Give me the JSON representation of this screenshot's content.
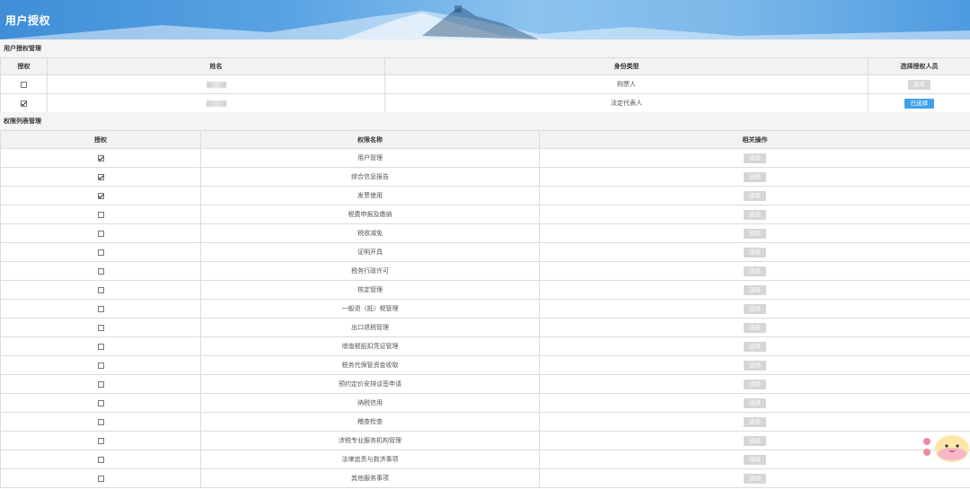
{
  "header": {
    "title": "用户授权"
  },
  "user_section": {
    "title": "用户授权管理",
    "columns": [
      "授权",
      "姓名",
      "身份类型",
      "选择授权人员"
    ],
    "rows": [
      {
        "checked": false,
        "identity": "购票人",
        "button": "选择",
        "button_state": "disabled"
      },
      {
        "checked": true,
        "identity": "法定代表人",
        "button": "已选择",
        "button_state": "active"
      }
    ]
  },
  "permission_section": {
    "title": "权限列表管理",
    "columns": [
      "授权",
      "权限名称",
      "相关操作"
    ],
    "button_label": "选择",
    "rows": [
      {
        "checked": true,
        "name": "用户管理"
      },
      {
        "checked": true,
        "name": "综合信息报告"
      },
      {
        "checked": true,
        "name": "发票使用"
      },
      {
        "checked": false,
        "name": "税费申报及缴纳"
      },
      {
        "checked": false,
        "name": "税收减免"
      },
      {
        "checked": false,
        "name": "证明开具"
      },
      {
        "checked": false,
        "name": "税务行政许可"
      },
      {
        "checked": false,
        "name": "核定管理"
      },
      {
        "checked": false,
        "name": "一般退（抵）税管理"
      },
      {
        "checked": false,
        "name": "出口退税管理"
      },
      {
        "checked": false,
        "name": "增值税抵扣凭证管理"
      },
      {
        "checked": false,
        "name": "税务代保管资金收取"
      },
      {
        "checked": false,
        "name": "预约定价安排谈签申请"
      },
      {
        "checked": false,
        "name": "纳税信用"
      },
      {
        "checked": false,
        "name": "稽查检查"
      },
      {
        "checked": false,
        "name": "涉税专业服务机构管理"
      },
      {
        "checked": false,
        "name": "法律追责与救济事项"
      },
      {
        "checked": false,
        "name": "其他服务事项"
      }
    ]
  },
  "colors": {
    "accent": "#3fa0ec",
    "disabled": "#d6d6d6",
    "banner": "#5aa3e3"
  }
}
